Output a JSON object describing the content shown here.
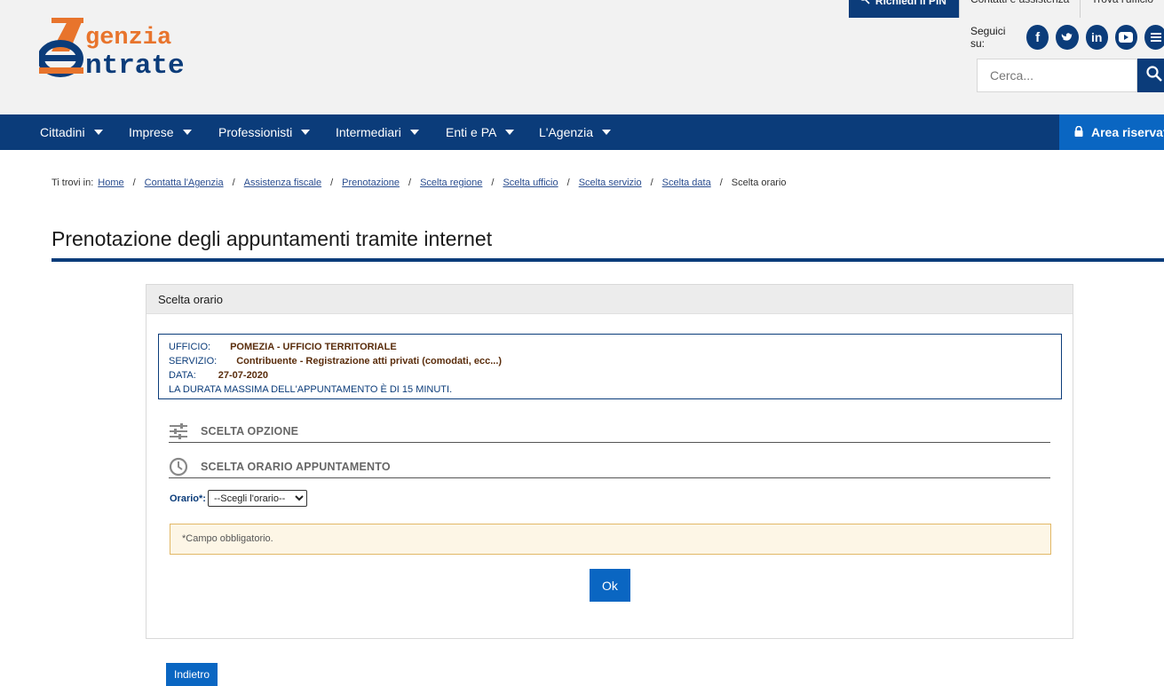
{
  "header": {
    "logo_line1": "genzia",
    "logo_line2": "ntrate",
    "top_links": {
      "pin": "Richiedi il PIN",
      "contacts": "Contatti e assistenza",
      "offices": "Trova l'ufficio"
    },
    "social_label": "Seguici su:",
    "social": [
      "f",
      "t",
      "in",
      "yt",
      "rss"
    ],
    "search_placeholder": "Cerca..."
  },
  "nav": {
    "items": [
      "Cittadini",
      "Imprese",
      "Professionisti",
      "Intermediari",
      "Enti e PA",
      "L'Agenzia"
    ],
    "area": "Area riservata"
  },
  "breadcrumb": {
    "prefix": "Ti trovi in:",
    "links": [
      "Home",
      "Contatta l'Agenzia",
      "Assistenza fiscale",
      "Prenotazione",
      "Scelta regione",
      "Scelta ufficio",
      "Scelta servizio",
      "Scelta data"
    ],
    "current": "Scelta orario"
  },
  "page_title": "Prenotazione degli appuntamenti tramite internet",
  "panel": {
    "title": "Scelta orario",
    "info": {
      "ufficio_label": "UFFICIO:",
      "ufficio": "POMEZIA - UFFICIO TERRITORIALE",
      "servizio_label": "SERVIZIO:",
      "servizio": "Contribuente - Registrazione atti privati (comodati, ecc...)",
      "data_label": "DATA:",
      "data": "27-07-2020",
      "durata": "LA DURATA MASSIMA DELL'APPUNTAMENTO È DI 15 MINUTI."
    },
    "section_option": "SCELTA OPZIONE",
    "section_time": "SCELTA ORARIO APPUNTAMENTO",
    "orario_label": "Orario*:",
    "orario_selected": "--Scegli l'orario--",
    "required_note": "*Campo obbligatorio.",
    "ok_label": "Ok"
  },
  "back_label": "Indietro",
  "colors": {
    "brand_blue": "#0b3c7a",
    "button_blue": "#0a66c2",
    "logo_orange": "#e8742c"
  }
}
